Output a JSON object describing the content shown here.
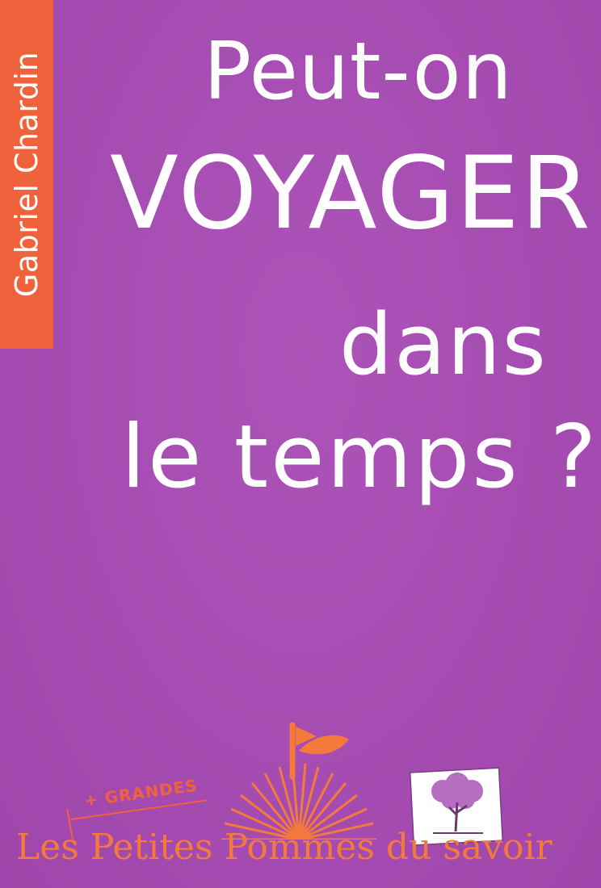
{
  "author": "Gabriel Chardin",
  "title_lines": [
    "Peut-on",
    "VOYAGER",
    "dans",
    "le temps ?"
  ],
  "badge": "+ GRANDES",
  "collection": "Les Petites Pommes du savoir",
  "colors": {
    "background": "#a84ab5",
    "author_band": "#f0623b",
    "title_text": "#ffffff",
    "brand_orange": "#f47a3c"
  },
  "icons": [
    "sun-apple-logo-icon",
    "tree-stamp-icon"
  ]
}
